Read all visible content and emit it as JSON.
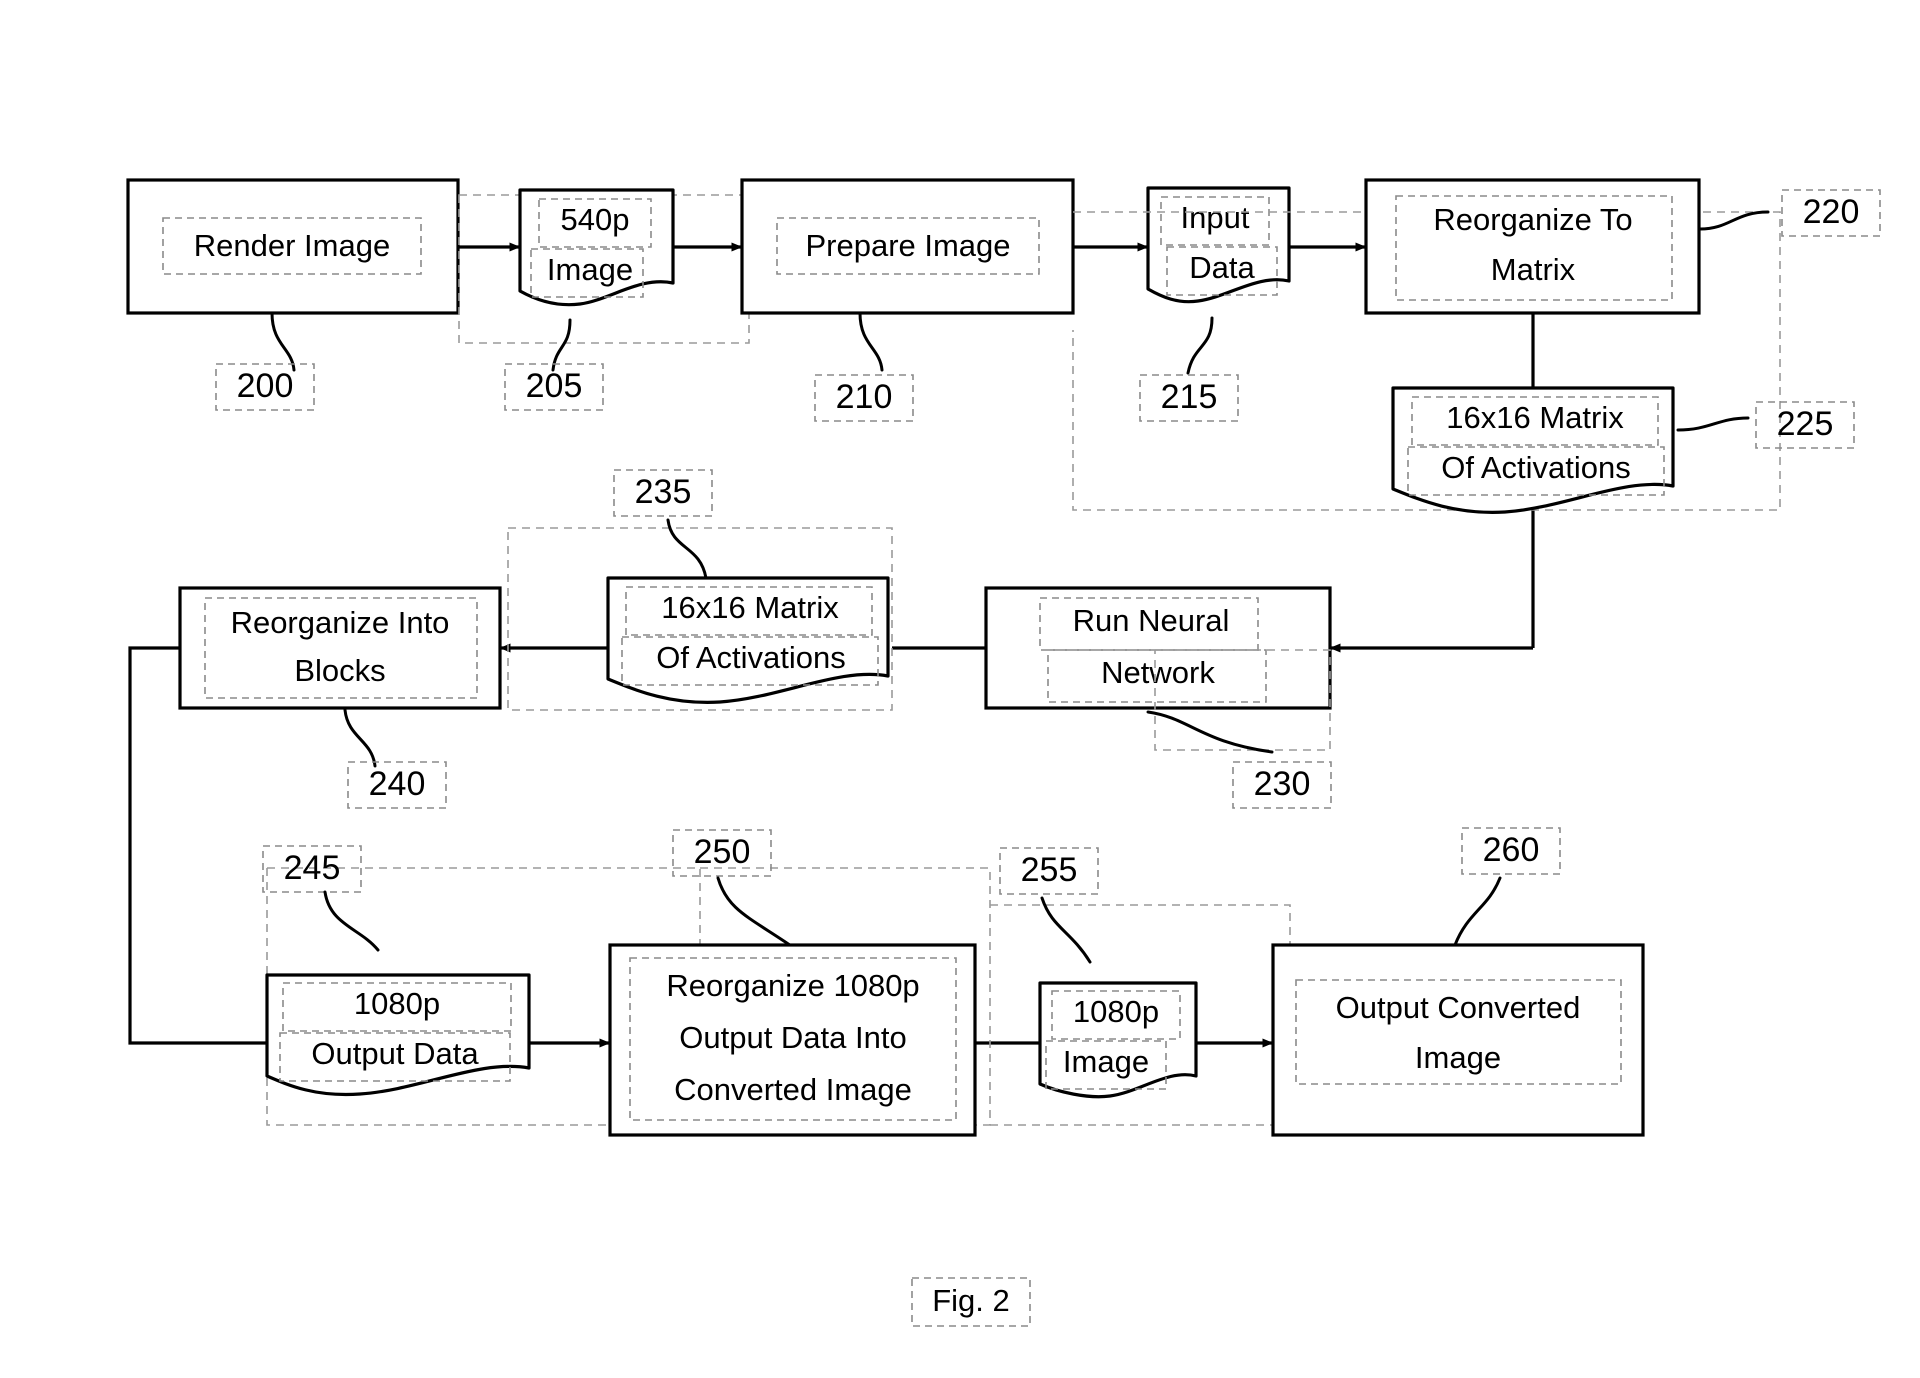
{
  "figure": {
    "caption": "Fig. 2",
    "type": "patent-flowchart"
  },
  "nodes": {
    "render_image": {
      "label_line1": "Render Image",
      "shape": "process",
      "ref": "200"
    },
    "image_540p": {
      "label_line1": "540p",
      "label_line2": "Image",
      "shape": "document",
      "ref": "205"
    },
    "prepare_image": {
      "label_line1": "Prepare Image",
      "shape": "process",
      "ref": "210"
    },
    "input_data": {
      "label_line1": "Input",
      "label_line2": "Data",
      "shape": "document",
      "ref": "215"
    },
    "reorganize_to_matrix": {
      "label_line1": "Reorganize To",
      "label_line2": "Matrix",
      "shape": "process",
      "ref": "220"
    },
    "matrix_activations_in": {
      "label_line1": "16x16 Matrix",
      "label_line2": "Of Activations",
      "shape": "document",
      "ref": "225"
    },
    "run_neural_network": {
      "label_line1": "Run Neural",
      "label_line2": "Network",
      "shape": "process",
      "ref": "230"
    },
    "matrix_activations_out": {
      "label_line1": "16x16 Matrix",
      "label_line2": "Of Activations",
      "shape": "document",
      "ref": "235"
    },
    "reorganize_into_blocks": {
      "label_line1": "Reorganize Into",
      "label_line2": "Blocks",
      "shape": "process",
      "ref": "240"
    },
    "output_data_1080p": {
      "label_line1": "1080p",
      "label_line2": "Output Data",
      "shape": "document",
      "ref": "245"
    },
    "reorganize_output": {
      "label_line1": "Reorganize 1080p",
      "label_line2": "Output Data Into",
      "label_line3": "Converted Image",
      "shape": "process",
      "ref": "250"
    },
    "image_1080p": {
      "label_line1": "1080p",
      "label_line2": "Image",
      "shape": "document",
      "ref": "255"
    },
    "output_converted_image": {
      "label_line1": "Output Converted",
      "label_line2": "Image",
      "shape": "process",
      "ref": "260"
    }
  },
  "reference_numerals": {
    "n200": "200",
    "n205": "205",
    "n210": "210",
    "n215": "215",
    "n220": "220",
    "n225": "225",
    "n230": "230",
    "n235": "235",
    "n240": "240",
    "n245": "245",
    "n250": "250",
    "n255": "255",
    "n260": "260"
  },
  "flow_order": [
    "Render Image",
    "540p Image",
    "Prepare Image",
    "Input Data",
    "Reorganize To Matrix",
    "16x16 Matrix Of Activations",
    "Run Neural Network",
    "16x16 Matrix Of Activations",
    "Reorganize Into Blocks",
    "1080p Output Data",
    "Reorganize 1080p Output Data Into Converted Image",
    "1080p Image",
    "Output Converted Image"
  ],
  "colors": {
    "stroke": "#000000",
    "background": "#ffffff",
    "ocr_box": "#8a8a8a"
  }
}
